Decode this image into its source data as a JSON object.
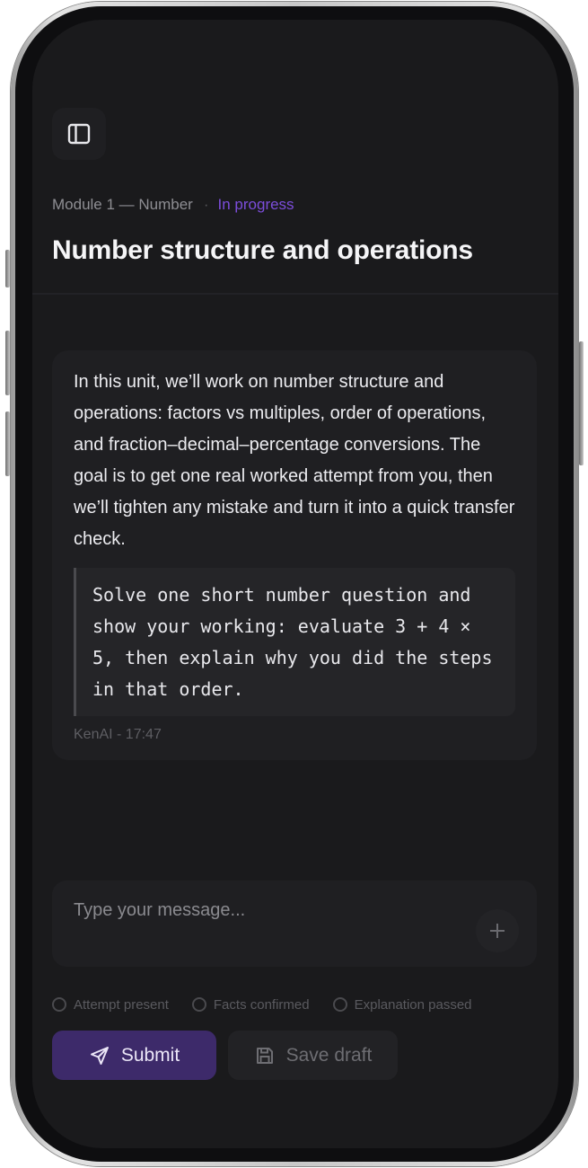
{
  "header": {
    "module": "Module 1 — Number",
    "separator": "·",
    "status": "In progress",
    "title": "Number structure and operations"
  },
  "message": {
    "text": "In this unit, we’ll work on number structure and operations: factors vs multiples, order of operations, and fraction–decimal–percentage conversions. The goal is to get one real worked attempt from you, then we’ll tighten any mistake and turn it into a quick transfer check.",
    "task": "Solve one short number question and show your working: evaluate 3 + 4 × 5, then explain why you did the steps in that order.",
    "meta": "KenAI - 17:47"
  },
  "composer": {
    "placeholder": "Type your message...",
    "value": ""
  },
  "checklist": [
    {
      "label": "Attempt present",
      "checked": false
    },
    {
      "label": "Facts confirmed",
      "checked": false
    },
    {
      "label": "Explanation passed",
      "checked": false
    }
  ],
  "actions": {
    "submit_label": "Submit",
    "draft_label": "Save draft"
  },
  "colors": {
    "accent": "#7c4ddb",
    "submit_bg": "#3d2a6a",
    "screen_bg": "#1a1a1c",
    "card_bg": "#1f1f22"
  },
  "icons": {
    "sidebar": "sidebar-toggle-icon",
    "add": "plus-icon",
    "submit": "send-icon",
    "draft": "save-icon"
  }
}
